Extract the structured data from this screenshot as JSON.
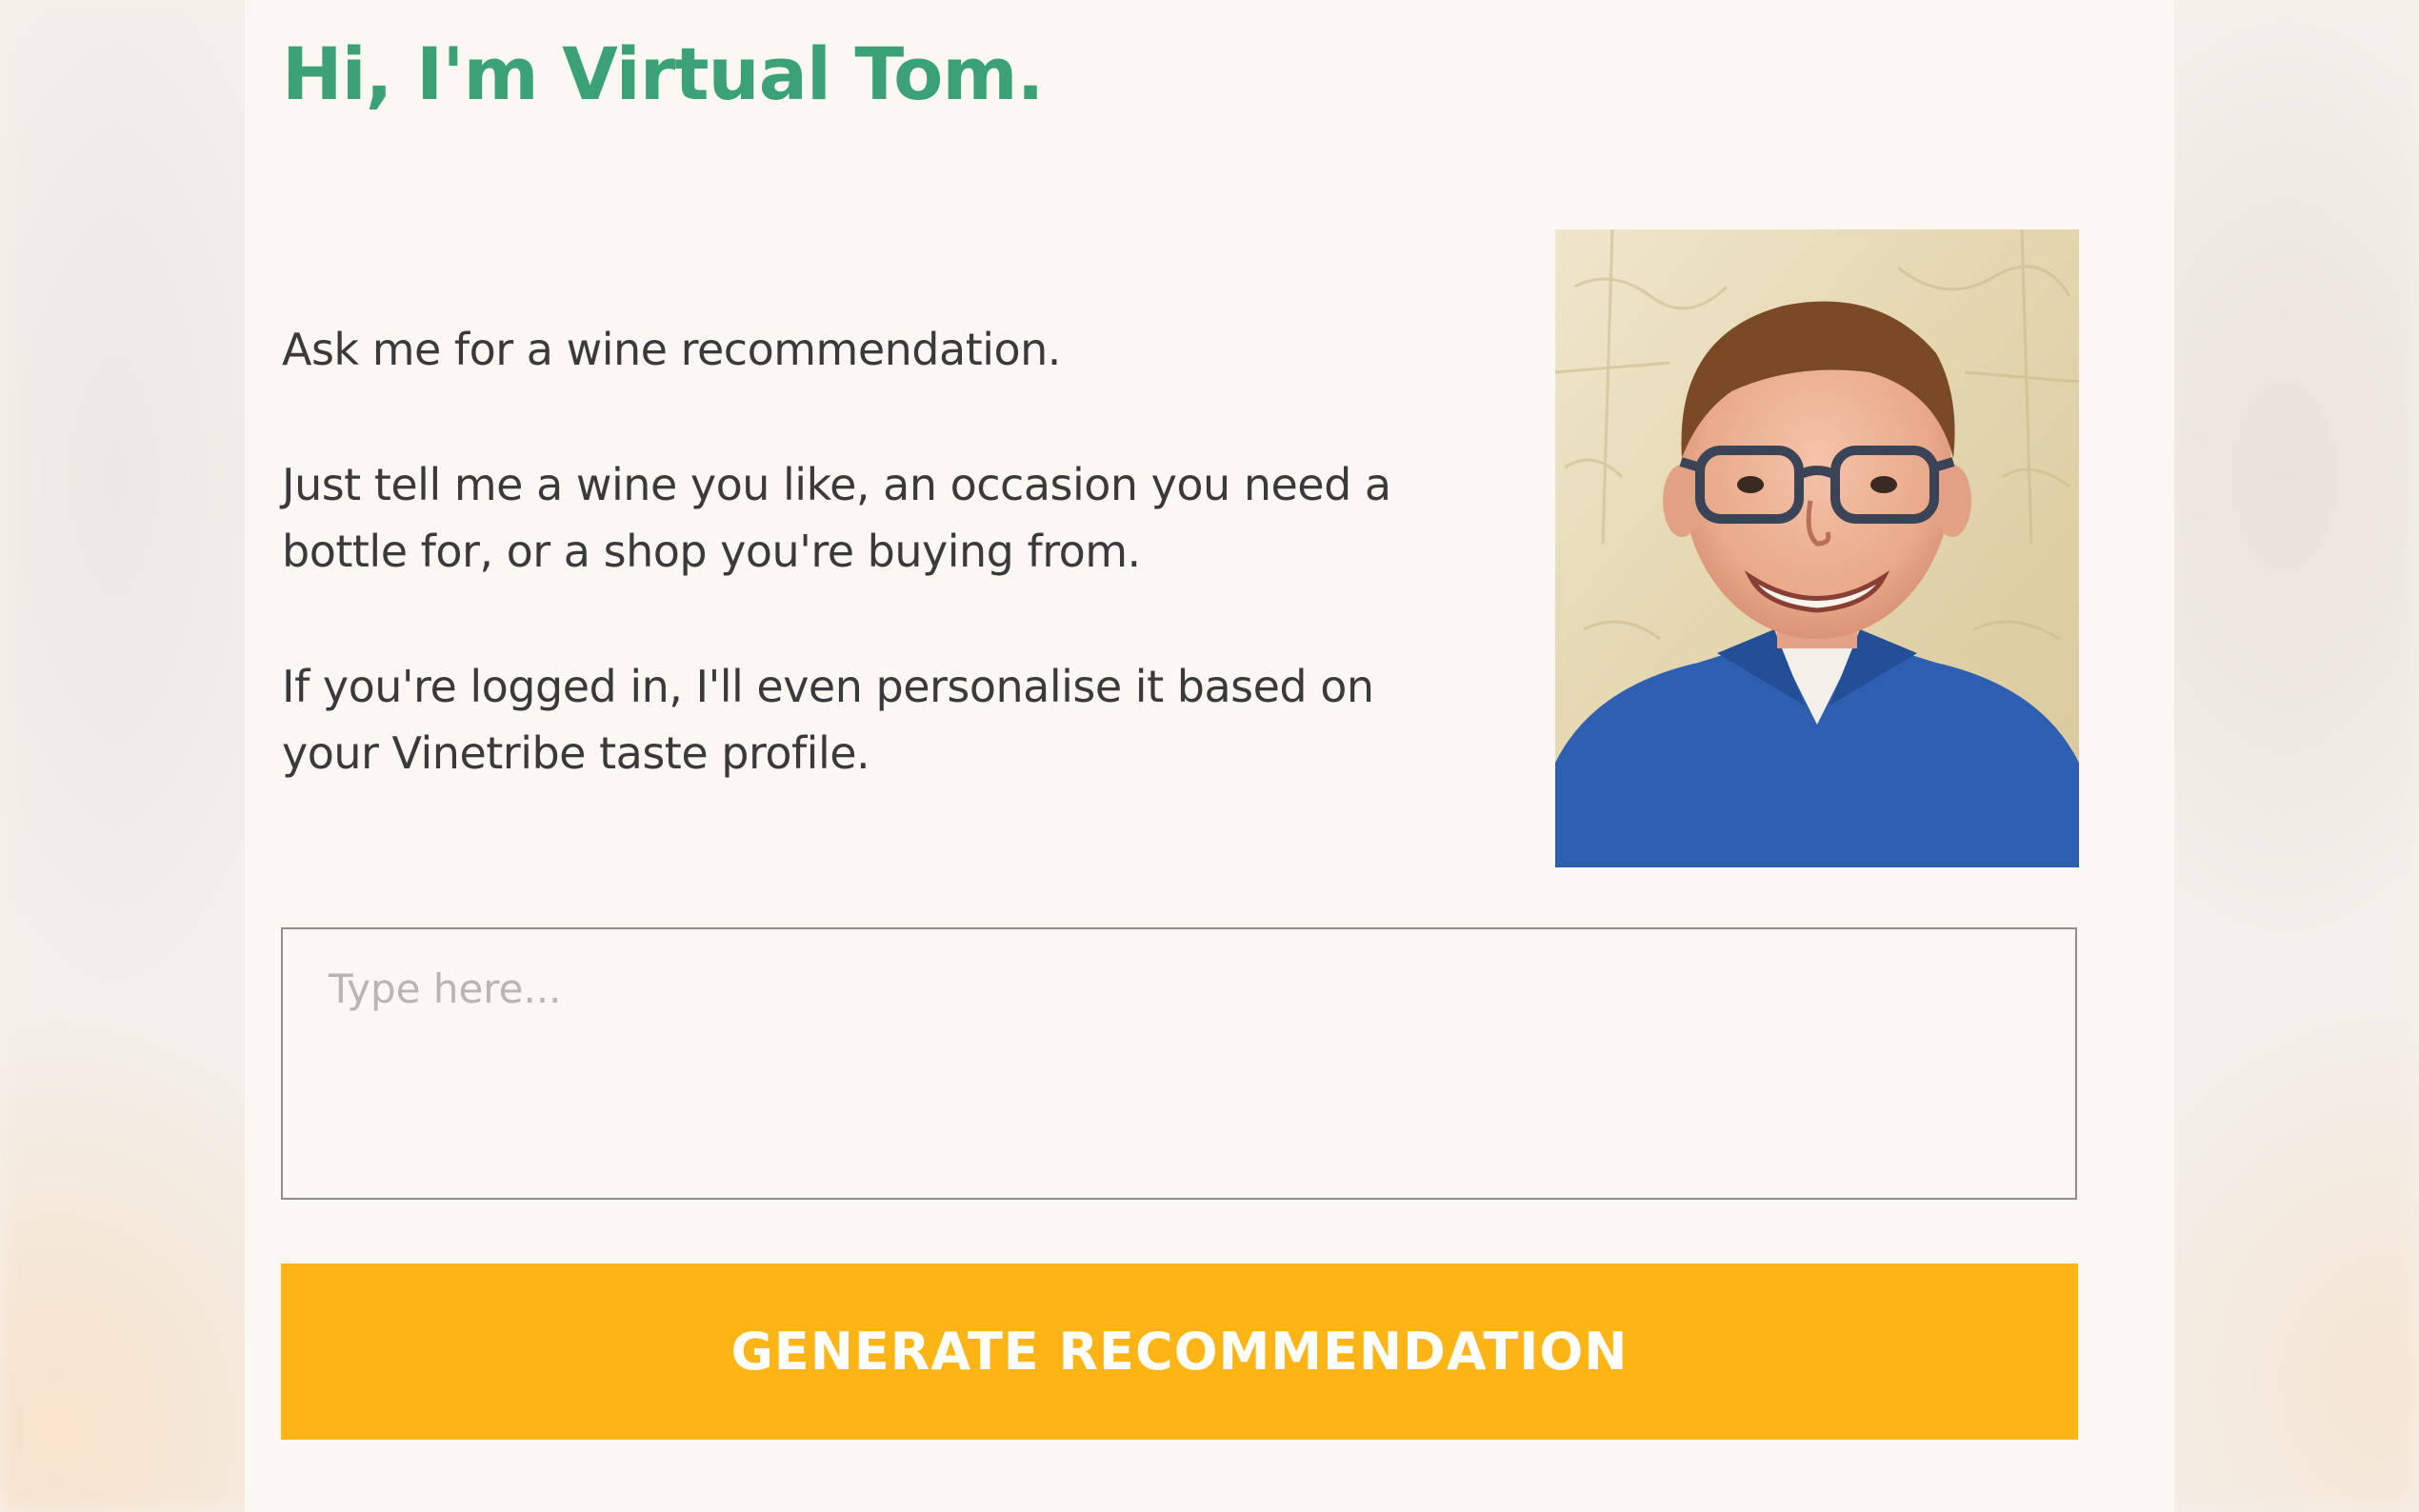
{
  "page": {
    "title": "Hi, I'm Virtual Tom."
  },
  "intro": {
    "line1": "Ask me for a wine recommendation.",
    "line2": "Just tell me a wine you like, an occasion you need a bottle for, or a shop you're buying from.",
    "line3": "If you're logged in, I'll even personalise it based on your Vinetribe taste profile."
  },
  "avatar": {
    "alt": "Virtual Tom"
  },
  "form": {
    "placeholder": "Type here...",
    "value": "",
    "button_label": "GENERATE RECOMMENDATION"
  },
  "colors": {
    "title": "#3aa276",
    "button": "#fdb515",
    "card_background": "#fbf8f3",
    "text": "#3a3a3a"
  }
}
